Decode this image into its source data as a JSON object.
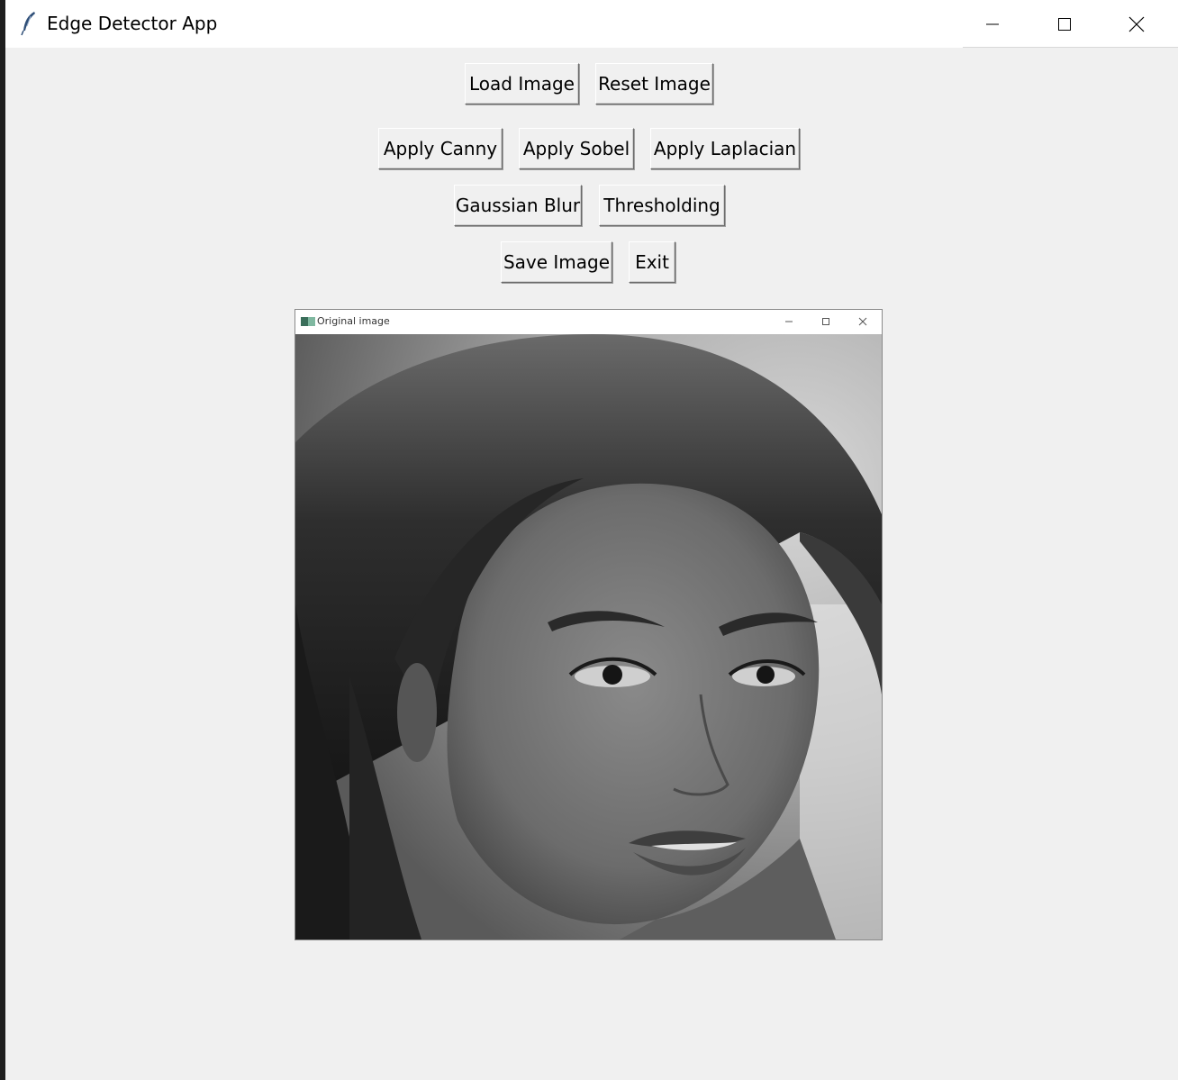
{
  "window": {
    "title": "Edge Detector App",
    "controls": {
      "minimize": "minimize-icon",
      "maximize": "maximize-icon",
      "close": "close-icon"
    }
  },
  "toolbar": {
    "row1": {
      "load": "Load Image",
      "reset": "Reset Image"
    },
    "row2": {
      "canny": "Apply Canny",
      "sobel": "Apply Sobel",
      "laplacian": "Apply Laplacian"
    },
    "row3": {
      "gaussian": "Gaussian Blur",
      "threshold": "Thresholding"
    },
    "row4": {
      "save": "Save Image",
      "exit": "Exit"
    }
  },
  "image_window": {
    "title": "Original image",
    "content": "grayscale portrait photo"
  },
  "colors": {
    "window_bg": "#f0f0f0",
    "titlebar_bg": "#ffffff",
    "button_bg": "#f0f0f0"
  }
}
